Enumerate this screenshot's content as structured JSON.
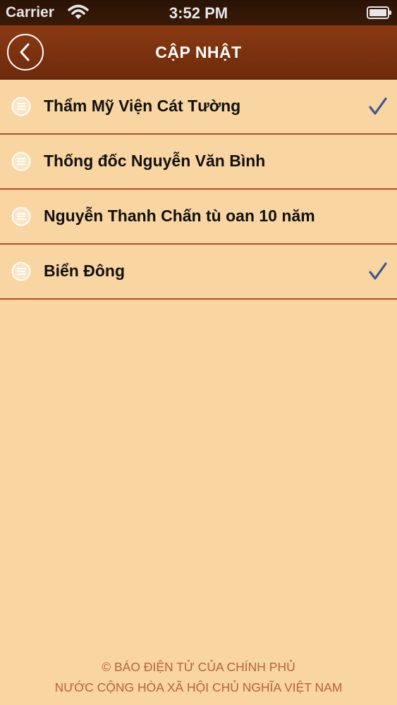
{
  "status_bar": {
    "carrier": "Carrier",
    "time": "3:52 PM"
  },
  "navbar": {
    "title": "CẬP NHẬT",
    "back_icon": "chevron-left-icon"
  },
  "list": {
    "items": [
      {
        "label": "Thẩm Mỹ Viện Cát Tường",
        "checked": true
      },
      {
        "label": "Thống đốc Nguyễn Văn Bình",
        "checked": false
      },
      {
        "label": "Nguyễn Thanh Chấn tù oan 10 năm",
        "checked": false
      },
      {
        "label": "Biển Đông",
        "checked": true
      }
    ]
  },
  "footer": {
    "line1": "© BÁO ĐIỆN TỬ CỦA CHÍNH PHỦ",
    "line2": "NƯỚC CỘNG HÒA XÃ HỘI CHỦ NGHĨA VIỆT NAM"
  },
  "colors": {
    "background": "#f9d5a2",
    "navbar": "#7a300f",
    "divider": "#b34f22",
    "check": "#3a5a8c",
    "footer_text": "#b3643a"
  }
}
